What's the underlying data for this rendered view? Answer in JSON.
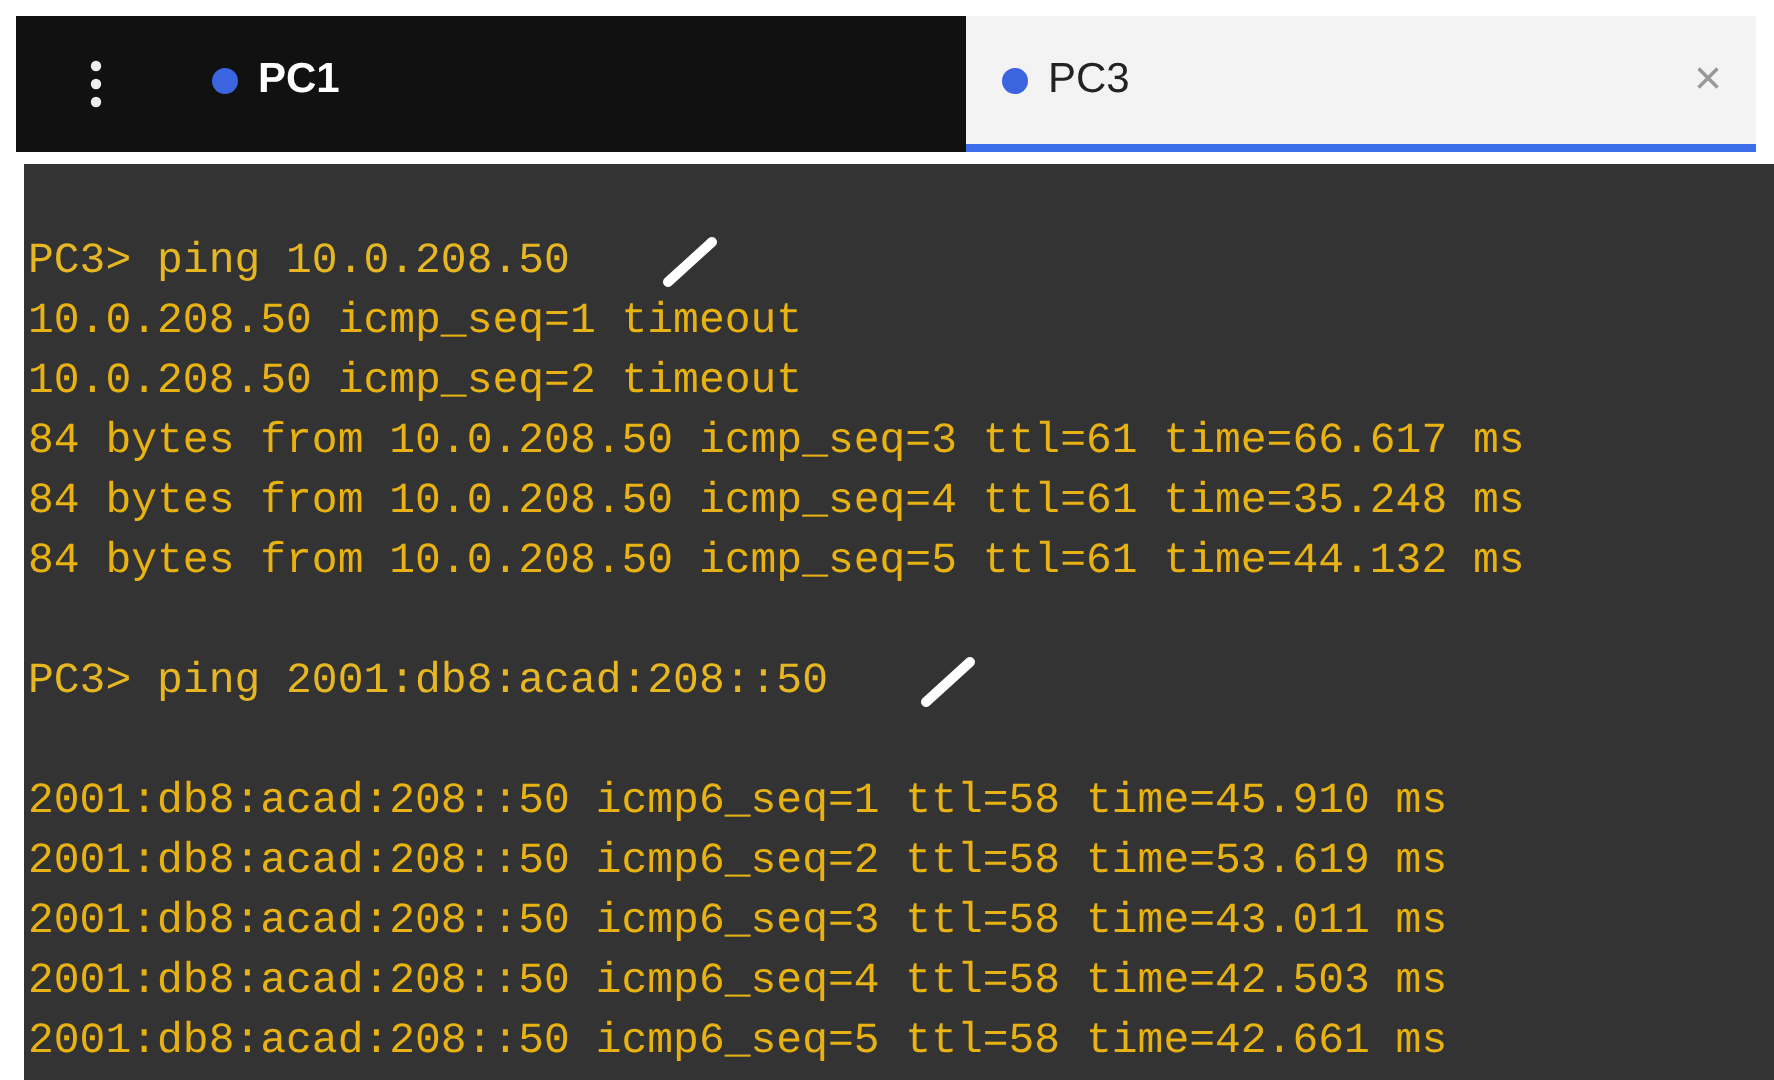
{
  "tabs": [
    {
      "label": "PC1",
      "selected": false
    },
    {
      "label": "PC3",
      "selected": true,
      "close": "×"
    }
  ],
  "terminal": {
    "lines": [
      {
        "kind": "prompt",
        "text": "PC3> ping 10.0.208.50",
        "annotated": true
      },
      {
        "kind": "output",
        "text": "10.0.208.50 icmp_seq=1 timeout"
      },
      {
        "kind": "output",
        "text": "10.0.208.50 icmp_seq=2 timeout"
      },
      {
        "kind": "output",
        "text": "84 bytes from 10.0.208.50 icmp_seq=3 ttl=61 time=66.617 ms"
      },
      {
        "kind": "output",
        "text": "84 bytes from 10.0.208.50 icmp_seq=4 ttl=61 time=35.248 ms"
      },
      {
        "kind": "output",
        "text": "84 bytes from 10.0.208.50 icmp_seq=5 ttl=61 time=44.132 ms"
      },
      {
        "kind": "blank"
      },
      {
        "kind": "prompt",
        "text": "PC3> ping 2001:db8:acad:208::50",
        "annotated": true
      },
      {
        "kind": "blank"
      },
      {
        "kind": "output",
        "text": "2001:db8:acad:208::50 icmp6_seq=1 ttl=58 time=45.910 ms"
      },
      {
        "kind": "output",
        "text": "2001:db8:acad:208::50 icmp6_seq=2 ttl=58 time=53.619 ms"
      },
      {
        "kind": "output",
        "text": "2001:db8:acad:208::50 icmp6_seq=3 ttl=58 time=43.011 ms"
      },
      {
        "kind": "output",
        "text": "2001:db8:acad:208::50 icmp6_seq=4 ttl=58 time=42.503 ms"
      },
      {
        "kind": "output",
        "text": "2001:db8:acad:208::50 icmp6_seq=5 ttl=58 time=42.661 ms"
      }
    ]
  }
}
